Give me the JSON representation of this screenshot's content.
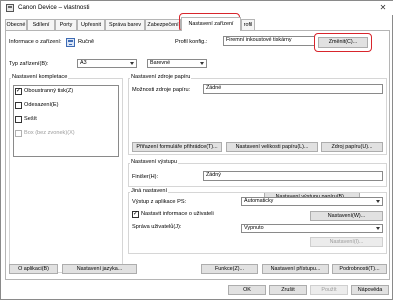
{
  "window": {
    "title": "Canon Device – vlastnosti",
    "close_glyph": "✕"
  },
  "tabs": [
    {
      "label": "Obecné"
    },
    {
      "label": "Sdílení"
    },
    {
      "label": "Porty"
    },
    {
      "label": "Upřesnit"
    },
    {
      "label": "Správa barev"
    },
    {
      "label": "Zabezpečení"
    },
    {
      "label": "Nastavení zařízení"
    },
    {
      "label": "rofil"
    }
  ],
  "info": {
    "label": "Informace o zařízení:",
    "mode": "Ručně"
  },
  "profile": {
    "label": "Profil konfig.:",
    "value": "Firemní inkoustové tiskárny",
    "change_button": "Změnit(C)..."
  },
  "device_type": {
    "label": "Typ zařízení(B):",
    "paper": "A3",
    "color": "Barevné"
  },
  "finishing": {
    "title": "Nastavení kompletace",
    "options": [
      {
        "label": "Oboustranný tisk(Z)",
        "checked": true,
        "disabled": false
      },
      {
        "label": "Odesazení(E)",
        "checked": false,
        "disabled": false
      },
      {
        "label": "Sešít",
        "checked": false,
        "disabled": false
      },
      {
        "label": "Box (bez zvonek)(X)",
        "checked": false,
        "disabled": true
      }
    ]
  },
  "paper_source": {
    "title": "Nastavení zdroje papíru",
    "option_label": "Možnosti zdroje papíru:",
    "option_value": "Žádné",
    "btn_assign": "Přiřazení formuláře přihrádce(T)...",
    "btn_size": "Nastavení velikosti papíru(L)...",
    "btn_source": "Zdroj papíru(U)..."
  },
  "output": {
    "title": "Nastavení výstupu",
    "finisher_label": "Finišer(H):",
    "finisher_value": "Žádný",
    "btn_output": "Nastavení výstupu papíru(B)..."
  },
  "other": {
    "title": "Jiná nastavení",
    "ps_label": "Výstup z aplikace PS:",
    "ps_value": "Automaticky",
    "user_info_label": "Nastavit informace o uživateli",
    "user_info_checked": true,
    "btn_settings": "Nastavení(W)...",
    "user_mgmt_label": "Správa uživatelů(J):",
    "user_mgmt_value": "Vypnuto",
    "btn_settings_disabled": "Nastavení(I)..."
  },
  "bottom": {
    "about": "O aplikaci(B)",
    "language": "Nastavení jazyka...",
    "functions": "Funkce(Z)...",
    "display": "Nastavení přístupu...",
    "details": "Podrobnosti(T)..."
  },
  "footer": {
    "ok": "OK",
    "cancel": "Zrušit",
    "apply": "Použít",
    "help": "Nápověda"
  }
}
